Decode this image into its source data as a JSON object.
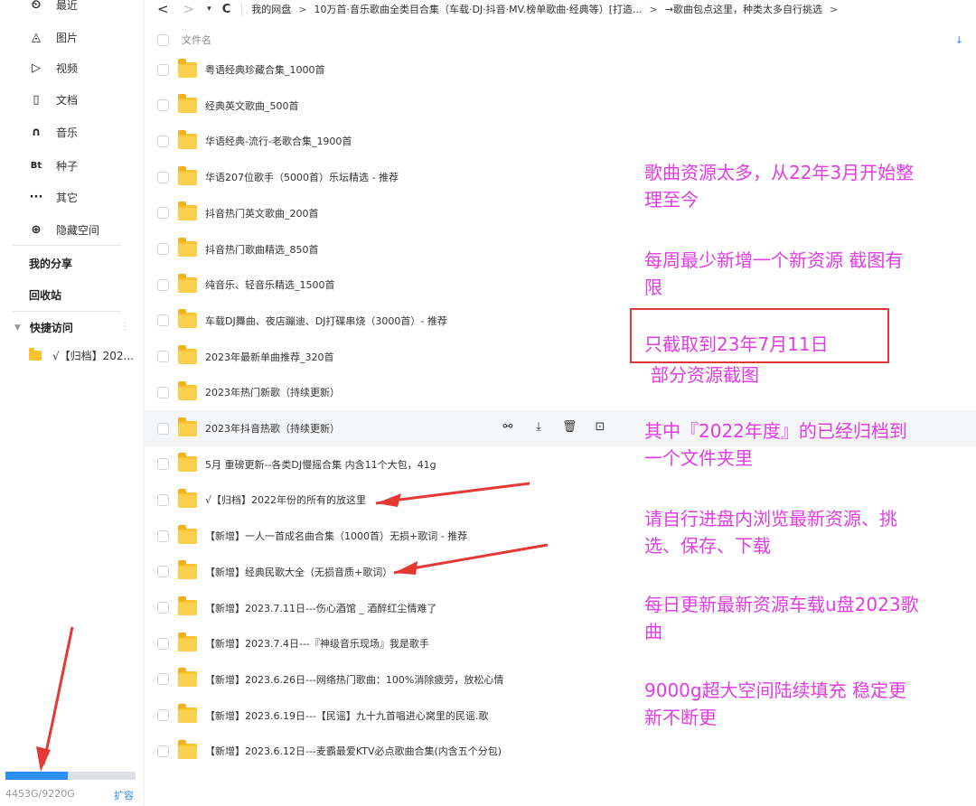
{
  "sidebar": {
    "items": [
      {
        "icon": "clock-icon",
        "glyph": "⏲",
        "label": "最近"
      },
      {
        "icon": "image-icon",
        "glyph": "◬",
        "label": "图片"
      },
      {
        "icon": "video-icon",
        "glyph": "▷",
        "label": "视频"
      },
      {
        "icon": "document-icon",
        "glyph": "▯",
        "label": "文档"
      },
      {
        "icon": "headphones-icon",
        "glyph": "∩",
        "label": "音乐"
      },
      {
        "icon": "bt-icon",
        "glyph": "Bt",
        "label": "种子"
      },
      {
        "icon": "more-icon",
        "glyph": "···",
        "label": "其它"
      },
      {
        "icon": "lock-icon",
        "glyph": "⊕",
        "label": "隐藏空间"
      }
    ],
    "my_share": "我的分享",
    "recycle": "回收站",
    "quick_access": "快捷访问",
    "quick_item": "√【归档】202..."
  },
  "storage": {
    "usage_text": "4453G/9220G",
    "used_fraction": 0.48,
    "expand": "扩容"
  },
  "nav": {
    "back": "<",
    "forward": ">",
    "dropdown": "▾",
    "refresh": "C",
    "crumbs": [
      "我的网盘",
      "10万首·音乐歌曲全类目合集（车载·DJ·抖音·MV.榜单歌曲·经典等）[打造...",
      "→歌曲包点这里，种类太多自行挑选"
    ],
    "separator": ">"
  },
  "list": {
    "column_name": "文件名",
    "sort_icon": "↓",
    "files": [
      "粤语经典珍藏合集_1000首",
      "经典英文歌曲_500首",
      "华语经典-流行-老歌合集_1900首",
      "华语207位歌手（5000首）乐坛精选 - 推荐",
      "抖音热门英文歌曲_200首",
      "抖音热门歌曲精选_850首",
      "纯音乐、轻音乐精选_1500首",
      "车载DJ舞曲、夜店蹦迪、DJ打碟串烧（3000首）- 推荐",
      "2023年最新单曲推荐_320首",
      "2023年热门新歌（持续更新）",
      "2023年抖音热歌（持续更新）",
      "5月 重磅更新--各类DJ慢摇合集 内含11个大包，41g",
      "√【归档】2022年份的所有的放这里",
      "【新增】一人一首成名曲合集（1000首）无损+歌词 - 推荐",
      "【新增】经典民歌大全（无损音质+歌词）",
      "【新增】2023.7.11日---伤心酒馆 _ 酒醉红尘情难了",
      "【新增】2023.7.4日---『神级音乐现场』我是歌手",
      "【新增】2023.6.26日---网络热门歌曲：100%消除疲劳，放松心情",
      "【新增】2023.6.19日---【民谣】九十九首唱进心窝里的民谣.歌",
      "【新增】2023.6.12日---麦霸最爱KTV必点歌曲合集(内含五个分包)"
    ],
    "hover_actions": [
      "share-icon",
      "download-icon",
      "delete-icon",
      "more-actions-icon"
    ]
  },
  "annotations": [
    "歌曲资源太多，从22年3月开始整\n理至今",
    "每周最少新增一个新资源  截图有\n限",
    "只截取到23年7月11日",
    "部分资源截图",
    "其中『2022年度』的已经归档到\n一个文件夹里",
    "请自行进盘内浏览最新资源、挑\n选、保存、下载",
    "每日更新最新资源车载u盘2023歌\n曲",
    "9000g超大空间陆续填充 稳定更\n新不断更"
  ],
  "colors": {
    "accent": "#2b8ff7",
    "folder": "#f9c333",
    "annotation": "#e23ce4",
    "arrow": "#e53935"
  }
}
